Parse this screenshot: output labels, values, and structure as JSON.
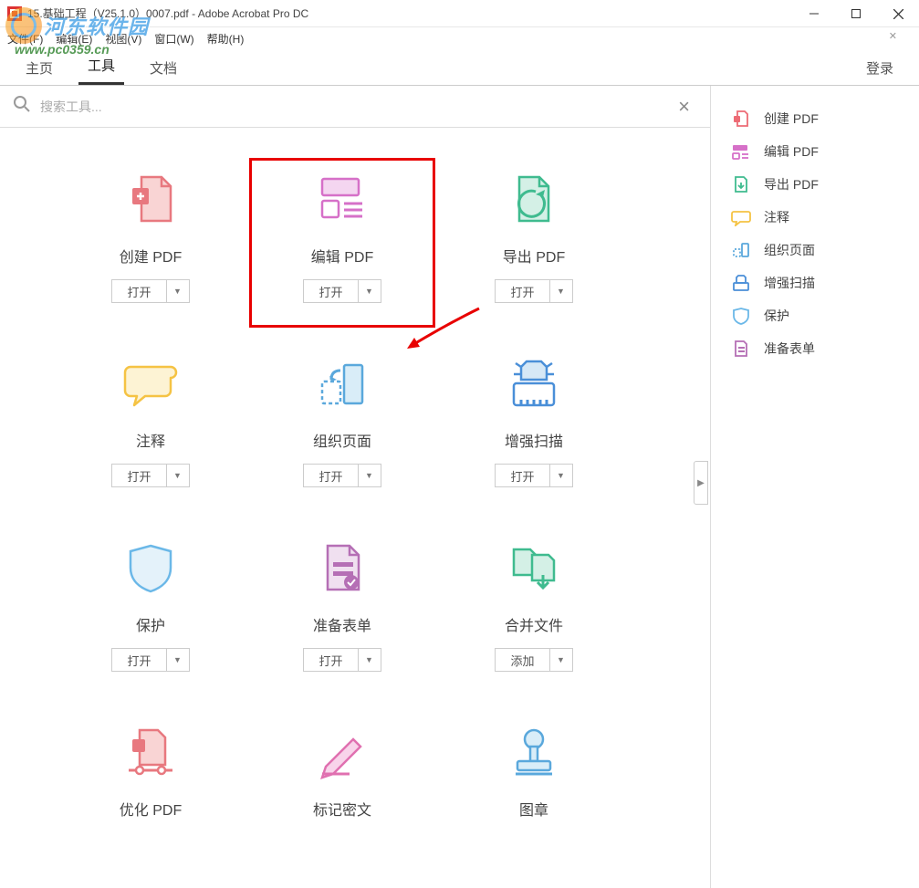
{
  "window": {
    "title": "15.基础工程（V25.1.0）0007.pdf - Adobe Acrobat Pro DC"
  },
  "menubar": {
    "file": "文件(F)",
    "edit": "编辑(E)",
    "view": "视图(V)",
    "window": "窗口(W)",
    "help": "帮助(H)"
  },
  "tabbar": {
    "home": "主页",
    "tools": "工具",
    "document": "文档",
    "login": "登录"
  },
  "search": {
    "placeholder": "搜索工具..."
  },
  "tools": [
    {
      "label": "创建 PDF",
      "action": "打开",
      "icon": "create-pdf"
    },
    {
      "label": "编辑 PDF",
      "action": "打开",
      "icon": "edit-pdf",
      "highlighted": true
    },
    {
      "label": "导出 PDF",
      "action": "打开",
      "icon": "export-pdf"
    },
    {
      "label": "注释",
      "action": "打开",
      "icon": "comment"
    },
    {
      "label": "组织页面",
      "action": "打开",
      "icon": "organize"
    },
    {
      "label": "增强扫描",
      "action": "打开",
      "icon": "scan"
    },
    {
      "label": "保护",
      "action": "打开",
      "icon": "protect"
    },
    {
      "label": "准备表单",
      "action": "打开",
      "icon": "form"
    },
    {
      "label": "合并文件",
      "action": "添加",
      "icon": "combine"
    },
    {
      "label": "优化 PDF",
      "action": "",
      "icon": "optimize"
    },
    {
      "label": "标记密文",
      "action": "",
      "icon": "redact"
    },
    {
      "label": "图章",
      "action": "",
      "icon": "stamp"
    }
  ],
  "sidebar": [
    {
      "label": "创建 PDF",
      "icon": "create-pdf",
      "color": "#ed6b75"
    },
    {
      "label": "编辑 PDF",
      "icon": "edit-pdf",
      "color": "#d670c8"
    },
    {
      "label": "导出 PDF",
      "icon": "export-pdf",
      "color": "#3fbb8f"
    },
    {
      "label": "注释",
      "icon": "comment",
      "color": "#f5c344"
    },
    {
      "label": "组织页面",
      "icon": "organize",
      "color": "#5aa8dc"
    },
    {
      "label": "增强扫描",
      "icon": "scan",
      "color": "#4a8fd8"
    },
    {
      "label": "保护",
      "icon": "protect",
      "color": "#6bb8e8"
    },
    {
      "label": "准备表单",
      "icon": "form",
      "color": "#b56fb5"
    }
  ],
  "watermark": {
    "text": "河东软件园",
    "url": "www.pc0359.cn"
  }
}
